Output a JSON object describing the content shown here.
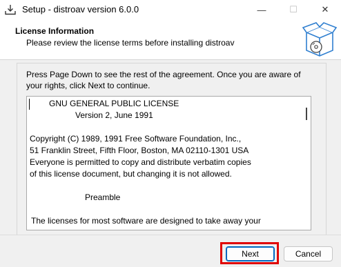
{
  "window": {
    "title": "Setup - distroav version 6.0.0",
    "minimize_glyph": "—",
    "maximize_glyph": "☐",
    "close_glyph": "✕",
    "app_icon": "download-tray-icon"
  },
  "header": {
    "title": "License Information",
    "subtitle": "Please review the license terms before installing distroav",
    "icon": "software-box-icon"
  },
  "instructions": "Press Page Down to see the rest of the agreement. Once you are aware of your rights, click Next to continue.",
  "license": {
    "lines": [
      "GNU GENERAL PUBLIC LICENSE",
      "Version 2, June 1991",
      "Copyright (C) 1989, 1991 Free Software Foundation, Inc.,",
      "51 Franklin Street, Fifth Floor, Boston, MA 02110-1301 USA",
      "Everyone is permitted to copy and distribute verbatim copies",
      "of this license document, but changing it is not allowed.",
      "Preamble",
      "The licenses for most software are designed to take away your"
    ]
  },
  "buttons": {
    "next": "Next",
    "cancel": "Cancel"
  },
  "colors": {
    "highlight": "#e00000",
    "accent": "#0067c0"
  }
}
